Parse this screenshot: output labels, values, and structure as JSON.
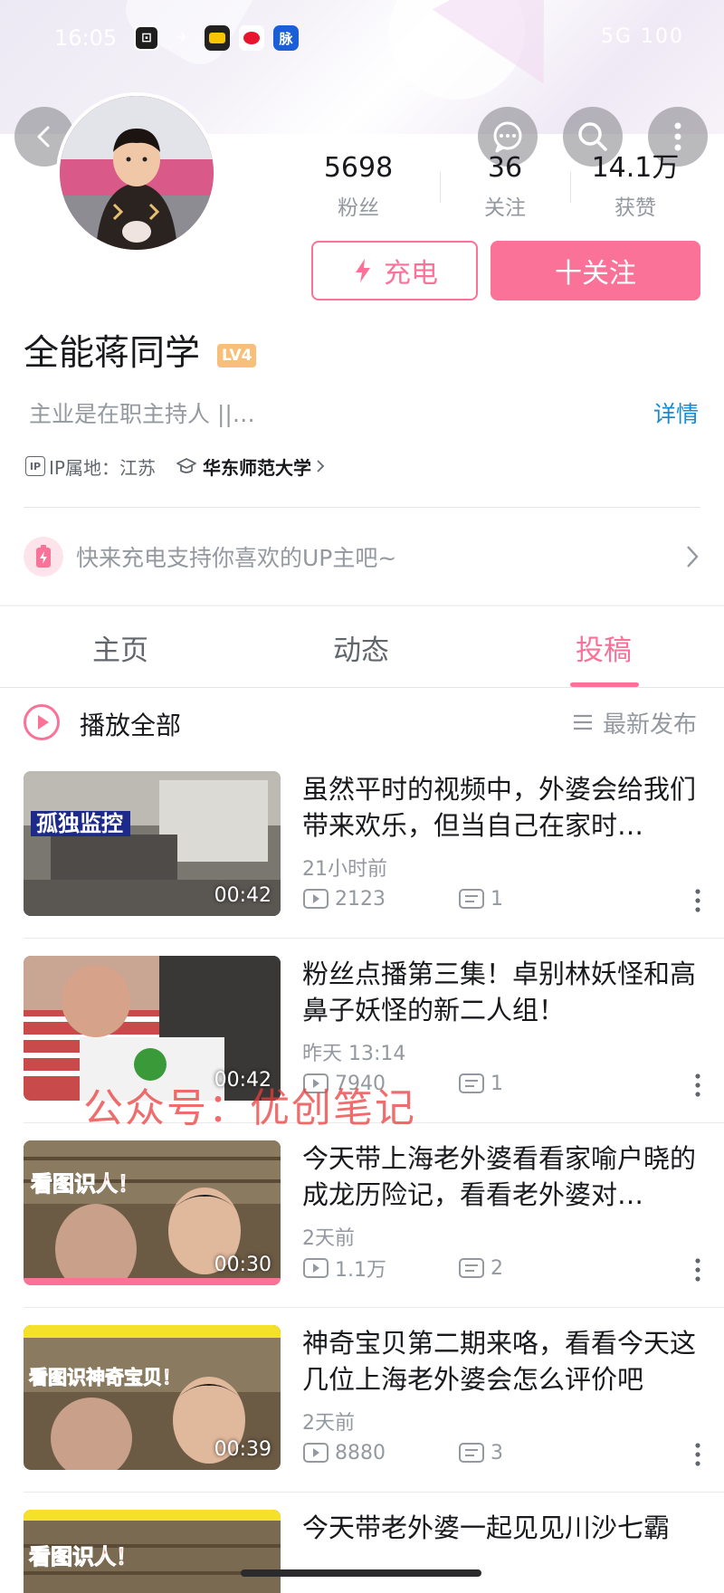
{
  "status_bar": {
    "time": "16:05",
    "apps": [
      {
        "name": "notion-app-icon",
        "glyph": "N",
        "bg": "#1e1e1e"
      },
      {
        "name": "taxi-app-icon",
        "glyph": "",
        "bg": "#222"
      },
      {
        "name": "weibo-app-icon",
        "glyph": "",
        "bg": "#ffffff"
      },
      {
        "name": "maimai-app-icon",
        "glyph": "脉",
        "bg": "#1a5fd8"
      }
    ],
    "right": "5G 100"
  },
  "profile": {
    "name": "全能蒋同学",
    "level": "LV4",
    "bio": "主业是在职主持人 ||…",
    "detail_label": "详情",
    "ip_label": "IP属地：江苏",
    "school": "华东师范大学",
    "stats": [
      {
        "value": "5698",
        "label": "粉丝"
      },
      {
        "value": "36",
        "label": "关注"
      },
      {
        "value": "14.1万",
        "label": "获赞"
      }
    ],
    "charge_label": "充电",
    "follow_label": "十关注"
  },
  "promo": {
    "text": "快来充电支持你喜欢的UP主吧~"
  },
  "tabs": [
    {
      "label": "主页",
      "active": false
    },
    {
      "label": "动态",
      "active": false
    },
    {
      "label": "投稿",
      "active": true
    }
  ],
  "list_header": {
    "play_all": "播放全部",
    "sort": "最新发布"
  },
  "videos": [
    {
      "title": "虽然平时的视频中，外婆会给我们带来欢乐，但当自己在家时…",
      "time": "21小时前",
      "views": "2123",
      "comments": "1",
      "duration": "00:42",
      "caption": "孤独监控"
    },
    {
      "title": "粉丝点播第三集！卓别林妖怪和高鼻子妖怪的新二人组！",
      "time": "昨天 13:14",
      "views": "7940",
      "comments": "1",
      "duration": "00:42",
      "caption": ""
    },
    {
      "title": "今天带上海老外婆看看家喻户晓的成龙历险记，看看老外婆对…",
      "time": "2天前",
      "views": "1.1万",
      "comments": "2",
      "duration": "00:30",
      "caption": "看图识人！"
    },
    {
      "title": "神奇宝贝第二期来咯，看看今天这几位上海老外婆会怎么评价吧",
      "time": "2天前",
      "views": "8880",
      "comments": "3",
      "duration": "00:39",
      "caption": "看图识神奇宝贝！"
    },
    {
      "title": "今天带老外婆一起见见川沙七霸",
      "time": "",
      "views": "",
      "comments": "",
      "duration": "",
      "caption": "看图识人！"
    }
  ],
  "watermark": "公众号：优创笔记",
  "colors": {
    "accent": "#fb7299",
    "link": "#178bcf",
    "muted": "#9499a0"
  }
}
